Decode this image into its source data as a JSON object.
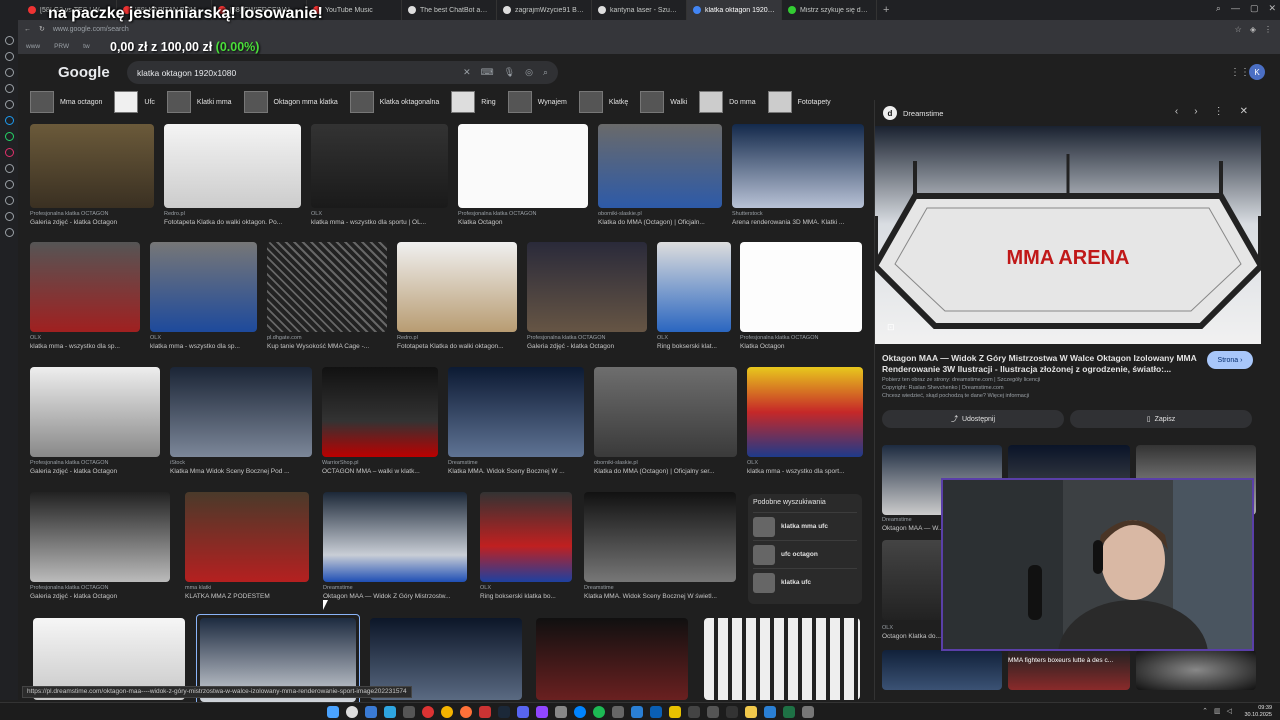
{
  "stream_overlay": {
    "title": "na paczkę jesienniarską! losowanie!",
    "money_a": "0,00 zł",
    "money_sep": "z",
    "money_b": "100,00 zł",
    "money_pct": "(0.00%)"
  },
  "browser": {
    "tabs": [
      {
        "label": "[58] G2 vs TES | WORLD"
      },
      {
        "label": "[58] KAPITAN BOMBA"
      },
      {
        "label": "[58] ĆWIERĆFINAŁY -"
      },
      {
        "label": "YouTube Music"
      },
      {
        "label": "The best ChatBot and W"
      },
      {
        "label": "zagrajmWzycie91 Battle"
      },
      {
        "label": "kantyna laser - Szukaj w"
      },
      {
        "label": "klatka oktagon 1920x108"
      },
      {
        "label": "Mistrz szykuje się do walki"
      }
    ],
    "url": "www.google.com/search",
    "bookmarks": [
      "www",
      "PRW",
      "tw"
    ]
  },
  "google": {
    "logo": "Google",
    "query": "klatka oktagon 1920x1080",
    "avatar_letter": "K"
  },
  "chips": [
    "Mma octagon",
    "Ufc",
    "Klatki mma",
    "Oktagon mma klatka",
    "Klatka oktagonalna",
    "Ring",
    "Wynajem",
    "Klatkę",
    "Walki",
    "Do mma",
    "Fototapety"
  ],
  "results": {
    "row1": [
      {
        "src": "Profesjonalna klatka OCTAGON",
        "title": "Galeria zdjęć - klatka Octagon"
      },
      {
        "src": "Redro.pl",
        "title": "Fototapeta Klatka do walki oktagon. Po..."
      },
      {
        "src": "OLX",
        "title": "klatka mma - wszystko dla sportu | OL..."
      },
      {
        "src": "Profesjonalna klatka OCTAGON",
        "title": "Klatka Octagon"
      },
      {
        "src": "oborniki-slaskie.pl",
        "title": "Klatka do MMA (Octagon) | Oficjaln..."
      },
      {
        "src": "Shutterstock",
        "title": "Arena renderowania 3D MMA. Klatki ..."
      }
    ],
    "row2": [
      {
        "src": "OLX",
        "title": "klatka mma - wszystko dla sp..."
      },
      {
        "src": "OLX",
        "title": "klatka mma - wszystko dla sp..."
      },
      {
        "src": "pl.dhgate.com",
        "title": "Kup tanie Wysokość MMA Cage -..."
      },
      {
        "src": "Redro.pl",
        "title": "Fototapeta Klatka do walki oktagon..."
      },
      {
        "src": "Profesjonalna klatka OCTAGON",
        "title": "Galeria zdjęć - klatka Octagon"
      },
      {
        "src": "OLX",
        "title": "Ring bokserski klat..."
      },
      {
        "src": "Profesjonalna klatka OCTAGON",
        "title": "Klatka Octagon"
      }
    ],
    "row3": [
      {
        "src": "Profesjonalna klatka OCTAGON",
        "title": "Galeria zdjęć - klatka Octagon"
      },
      {
        "src": "iStock",
        "title": "Klatka Mma Widok Sceny Bocznej Pod ..."
      },
      {
        "src": "WarriorShop.pl",
        "title": "OCTAGON MMA – walki w klatk..."
      },
      {
        "src": "Dreamstime",
        "title": "Klatka MMA. Widok Sceny Bocznej W ..."
      },
      {
        "src": "oborniki-slaskie.pl",
        "title": "Klatka do MMA (Octagon) | Oficjalny ser..."
      },
      {
        "src": "OLX",
        "title": "klatka mma - wszystko dla sport..."
      }
    ],
    "row4": [
      {
        "src": "Profesjonalna klatka OCTAGON",
        "title": "Galeria zdjęć - klatka Octagon"
      },
      {
        "src": "mma klatki",
        "title": "KLATKA MMA Z PODESTEM"
      },
      {
        "src": "Dreamstime",
        "title": "Oktagon MAA — Widok Z Góry Mistrzostw..."
      },
      {
        "src": "OLX",
        "title": "Ring bokserski klatka bo..."
      },
      {
        "src": "Dreamstime",
        "title": "Klatka MMA. Widok Sceny Bocznej W świetl..."
      }
    ],
    "related": {
      "heading": "Podobne wyszukiwania",
      "items": [
        "klatka mma ufc",
        "ufc octagon",
        "klatka ufc"
      ]
    }
  },
  "panel": {
    "source": "Dreamstime",
    "arena_text": "MMA ARENA",
    "title": "Oktagon MAA — Widok Z Góry Mistrzostwa W Walce Oktagon Izolowany MMA Renderowanie 3W Ilustracji - Ilustracja złożonej z ogrodzenie, światło:...",
    "visit_label": "Strona ›",
    "meta1": "Pobierz ten obraz ze strony: dreamstime.com | Szczegóły licencji",
    "meta2": "Copyright: Ruslan Shevchenko | Dreamstime.com",
    "meta3": "Chcesz wiedzieć, skąd pochodzą te dane? Więcej informacji",
    "share_label": "Udostępnij",
    "save_label": "Zapisz",
    "tiles": [
      {
        "src": "Dreamstime",
        "title": "Oktagon MAA — W..."
      },
      {
        "src": "OLX",
        "title": "Octagon Klatka do..."
      },
      {
        "src": "",
        "title": "MMA fighters boxeurs lutte à des c..."
      }
    ]
  },
  "status_url": "https://pl.dreamstime.com/oktagon-maa----widok-z-góry-mistrzostwa-w-walce-izolowany-mma-renderowanie-sport-image202231574",
  "clock": {
    "time": "09:39",
    "date": "30.10.2025"
  },
  "colors": {
    "accent": "#a8c7fa",
    "money_green": "#4ade3a",
    "webcam_border": "#5a3fa8"
  }
}
